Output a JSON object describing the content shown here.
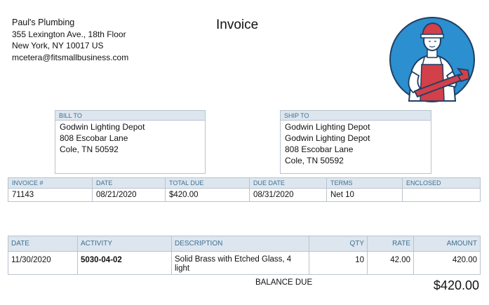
{
  "document": {
    "title": "Invoice"
  },
  "company": {
    "name": "Paul's Plumbing",
    "address_line1": "355 Lexington Ave., 18th Floor",
    "address_line2": "New York, NY  10017 US",
    "email": "mcetera@fitsmallbusiness.com"
  },
  "logo": {
    "icon": "plumber-with-wrench-logo",
    "colors": {
      "circle": "#2b8fd0",
      "outline": "#1f3e63",
      "accent": "#d2404a"
    }
  },
  "bill_to": {
    "label": "BILL TO",
    "lines": [
      "Godwin Lighting Depot",
      "808 Escobar Lane",
      "Cole, TN  50592"
    ]
  },
  "ship_to": {
    "label": "SHIP TO",
    "lines": [
      "Godwin Lighting Depot",
      "Godwin Lighting Depot",
      "808 Escobar Lane",
      "Cole, TN  50592"
    ]
  },
  "meta": {
    "headers": [
      "INVOICE #",
      "DATE",
      "TOTAL DUE",
      "DUE DATE",
      "TERMS",
      "ENCLOSED"
    ],
    "values": [
      "71143",
      "08/21/2020",
      "$420.00",
      "08/31/2020",
      "Net 10",
      ""
    ]
  },
  "items": {
    "headers": {
      "date": "DATE",
      "activity": "ACTIVITY",
      "description": "DESCRIPTION",
      "qty": "QTY",
      "rate": "RATE",
      "amount": "AMOUNT"
    },
    "rows": [
      {
        "date": "11/30/2020",
        "activity": "5030-04-02",
        "description": "Solid Brass with Etched Glass, 4 light",
        "qty": "10",
        "rate": "42.00",
        "amount": "420.00"
      }
    ]
  },
  "balance": {
    "label": "BALANCE DUE",
    "value": "$420.00"
  },
  "colors": {
    "header_bg": "#dde6ee",
    "header_text": "#3d6f93",
    "border": "#b9c3cc"
  }
}
